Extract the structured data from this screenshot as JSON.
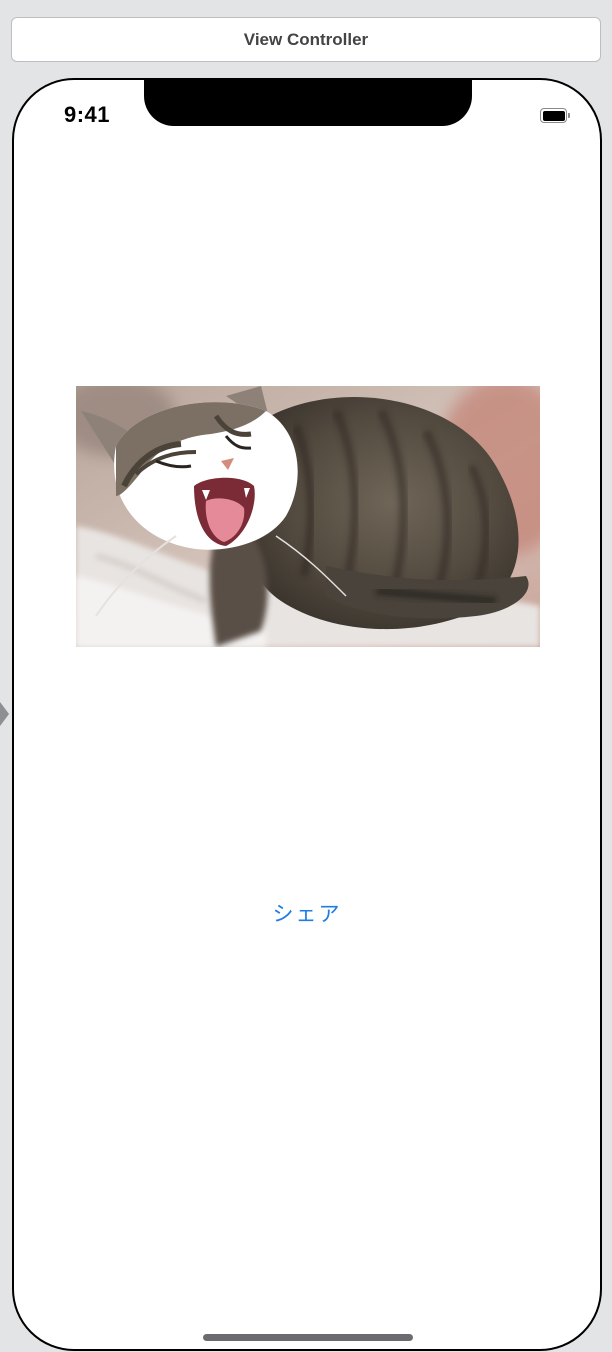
{
  "scene": {
    "title": "View Controller"
  },
  "status_bar": {
    "time": "9:41",
    "battery_icon": "battery-full-icon"
  },
  "content": {
    "image": "photo of a yawning tabby cat lying on a blanket",
    "share_button_label": "シェア"
  },
  "colors": {
    "canvas_background": "#e3e4e6",
    "tint": "#1f7ce0",
    "device_bezel": "#000000"
  }
}
